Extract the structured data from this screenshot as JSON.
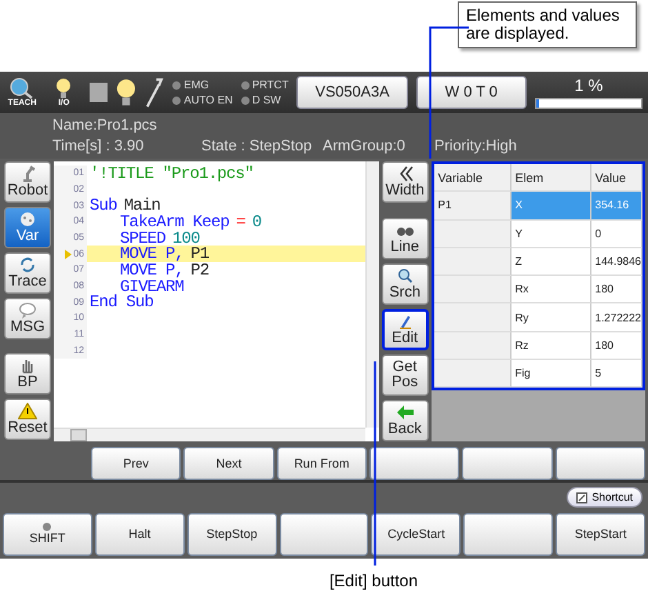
{
  "callouts": [
    {
      "text": "Elements and values are displayed."
    },
    {
      "text": "[Edit] button"
    }
  ],
  "toolbar": {
    "teach_label": "TEACH",
    "io_label": "I/O",
    "indicators": [
      {
        "label": "EMG",
        "on": false
      },
      {
        "label": "PRTCT",
        "on": false
      },
      {
        "label": "AUTO EN",
        "on": false
      },
      {
        "label": "D SW",
        "on": false
      }
    ],
    "buttons": [
      "VS050A3A",
      "W 0 T 0"
    ],
    "speed": {
      "reading": "1 %",
      "level": 0.02
    }
  },
  "info": {
    "name": "Name:Pro1.pcs",
    "time": "Time[s] : 3.90",
    "state": "State : StepStop",
    "arm_group": "ArmGroup:0",
    "priority": "Priority:High"
  },
  "left_buttons": [
    {
      "label": "Robot",
      "selected": false
    },
    {
      "label": "Var",
      "selected": true
    },
    {
      "label": "Trace",
      "selected": false
    },
    {
      "label": "MSG",
      "selected": false
    },
    {
      "label": "BP",
      "selected": false
    },
    {
      "label": "Reset",
      "selected": false
    }
  ],
  "editor": {
    "lines": [
      {
        "number": "01",
        "indented": false,
        "current": false,
        "tokens": [
          {
            "kind": "comment",
            "text": "'!TITLE \"Pro1.pcs\""
          }
        ]
      },
      {
        "number": "02",
        "current": false
      },
      {
        "number": "03",
        "indented": false,
        "current": false,
        "tokens": [
          {
            "kind": "keyword",
            "text": "Sub"
          },
          {
            "kind": "plain",
            "text": "Main"
          }
        ]
      },
      {
        "number": "04",
        "indented": true,
        "current": false,
        "tokens": [
          {
            "kind": "keyword",
            "text": "TakeArm Keep"
          },
          {
            "kind": "operator",
            "text": "="
          },
          {
            "kind": "number",
            "text": "0"
          }
        ]
      },
      {
        "number": "05",
        "indented": true,
        "current": false,
        "tokens": [
          {
            "kind": "keyword",
            "text": "SPEED"
          },
          {
            "kind": "number",
            "text": "100"
          }
        ]
      },
      {
        "number": "06",
        "indented": true,
        "current": true,
        "tokens": [
          {
            "kind": "keyword",
            "text": "MOVE P,"
          },
          {
            "kind": "plain",
            "text": "P1"
          }
        ]
      },
      {
        "number": "07",
        "indented": true,
        "current": false,
        "tokens": [
          {
            "kind": "keyword",
            "text": "MOVE P,"
          },
          {
            "kind": "plain",
            "text": "P2"
          }
        ]
      },
      {
        "number": "08",
        "indented": true,
        "current": false,
        "tokens": [
          {
            "kind": "keyword",
            "text": "GIVEARM"
          }
        ]
      },
      {
        "number": "09",
        "indented": false,
        "current": false,
        "tokens": [
          {
            "kind": "keyword",
            "text": "End Sub"
          }
        ]
      },
      {
        "number": "10",
        "current": false
      },
      {
        "number": "11",
        "current": false
      },
      {
        "number": "12",
        "current": false
      }
    ]
  },
  "right_buttons": [
    {
      "label": "Width",
      "highlighted": false
    },
    {
      "label": "Line",
      "highlighted": false
    },
    {
      "label": "Srch",
      "highlighted": false
    },
    {
      "label": "Edit",
      "highlighted": true
    },
    {
      "label": "Get Pos",
      "highlighted": false
    },
    {
      "label": "Back",
      "highlighted": false
    }
  ],
  "table": {
    "highlighted": true,
    "columns": [
      "Variable",
      "Elem",
      "Value"
    ],
    "rows": [
      {
        "variable": "P1",
        "elem": "X",
        "value": "354.16",
        "selected": true
      },
      {
        "elem": "Y",
        "value": "0",
        "selected": false
      },
      {
        "elem": "Z",
        "value": "144.9846",
        "selected": false
      },
      {
        "elem": "Rx",
        "value": "180",
        "selected": false
      },
      {
        "elem": "Ry",
        "value": "1.272222",
        "selected": false
      },
      {
        "elem": "Rz",
        "value": "180",
        "selected": false
      },
      {
        "elem": "Fig",
        "value": "5",
        "selected": false
      }
    ]
  },
  "function_buttons": [
    {
      "kind": "label",
      "label": "Prev"
    },
    {
      "kind": "label",
      "label": "Next"
    },
    {
      "kind": "label",
      "label": "Run From"
    },
    {
      "kind": "blank"
    },
    {
      "kind": "blank"
    },
    {
      "kind": "blank"
    }
  ],
  "shortcut": "Shortcut",
  "bottom_buttons": [
    {
      "kind": "shift",
      "label": "SHIFT"
    },
    {
      "kind": "label",
      "label": "Halt"
    },
    {
      "kind": "label",
      "label": "StepStop"
    },
    {
      "kind": "blank"
    },
    {
      "kind": "label",
      "label": "CycleStart"
    },
    {
      "kind": "blank"
    },
    {
      "kind": "label",
      "label": "StepStart"
    }
  ]
}
